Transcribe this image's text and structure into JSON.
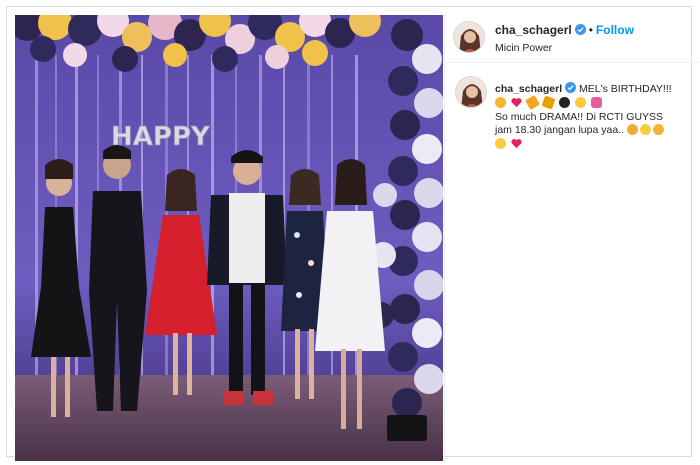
{
  "post": {
    "username": "cha_schagerl",
    "follow_label": "Follow",
    "separator": "•",
    "location": "Micin Power",
    "caption": {
      "line1": "MEL's BIRTHDAY!!!",
      "line2": "So much DRAMA!! Di RCTI GUYSS",
      "line3": "jam 18.30 jangan lupa yaa.."
    },
    "photo_banner_text": "HAPPY"
  },
  "colors": {
    "link": "#0095f6",
    "text": "#262626",
    "border": "#dbdbdb"
  }
}
